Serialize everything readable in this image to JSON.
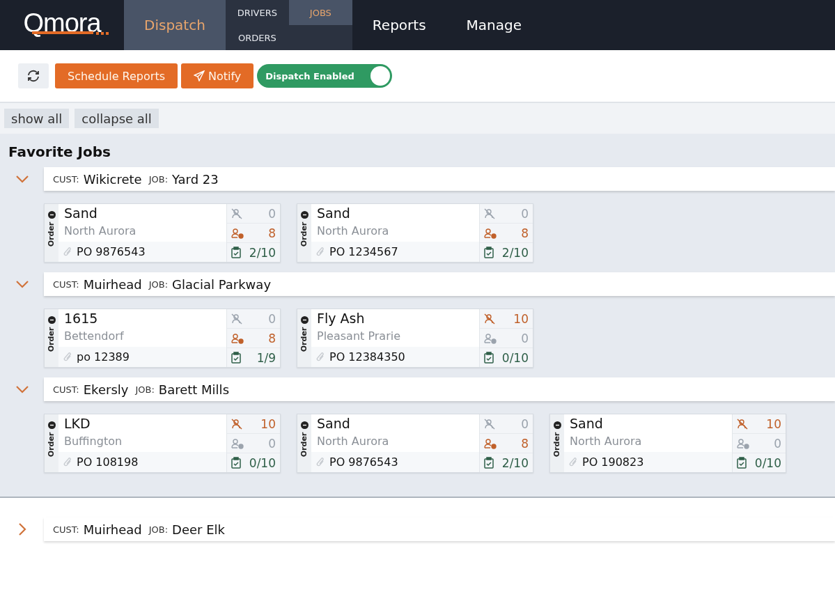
{
  "nav": {
    "logo": "Qmora",
    "tabs": [
      {
        "label": "Dispatch",
        "selected": true
      },
      {
        "kind": "sub",
        "items": [
          {
            "label": "DRIVERS",
            "selected": false
          },
          {
            "label": "JOBS",
            "selected": true
          },
          {
            "label": "ORDERS",
            "selected": false
          }
        ]
      },
      {
        "label": "Reports",
        "selected": false
      },
      {
        "label": "Manage",
        "selected": false
      }
    ]
  },
  "toolbar": {
    "buttons": [
      "Schedule Reports",
      "Notify"
    ],
    "toggle": {
      "label": "Dispatch Enabled",
      "on": true
    }
  },
  "view_buttons": [
    "show all",
    "collapse all"
  ],
  "section_title": "Favorite Jobs",
  "groups": [
    {
      "expanded": true,
      "cust_label": "CUST:",
      "customer": "Wikicrete",
      "job_label": "JOB:",
      "job": "Yard 23",
      "orders": [
        {
          "tag": "Order",
          "material": "Sand",
          "location": "North Aurora",
          "po": "PO 9876543",
          "stats": [
            {
              "kind": "unassigned",
              "value": "0",
              "active": false
            },
            {
              "kind": "assigned",
              "value": "8",
              "active": true
            },
            {
              "kind": "loads",
              "value": "2/10",
              "active": true
            }
          ]
        },
        {
          "tag": "Order",
          "material": "Sand",
          "location": "North Aurora",
          "po": "PO 1234567",
          "stats": [
            {
              "kind": "unassigned",
              "value": "0",
              "active": false
            },
            {
              "kind": "assigned",
              "value": "8",
              "active": true
            },
            {
              "kind": "loads",
              "value": "2/10",
              "active": true
            }
          ]
        }
      ]
    },
    {
      "expanded": true,
      "cust_label": "CUST:",
      "customer": "Muirhead",
      "job_label": "JOB:",
      "job": "Glacial Parkway",
      "orders": [
        {
          "tag": "Order",
          "material": "1615",
          "location": "Bettendorf",
          "po": "po 12389",
          "stats": [
            {
              "kind": "unassigned",
              "value": "0",
              "active": false
            },
            {
              "kind": "assigned",
              "value": "8",
              "active": true
            },
            {
              "kind": "loads",
              "value": "1/9",
              "active": true
            }
          ]
        },
        {
          "tag": "Order",
          "material": "Fly Ash",
          "location": "Pleasant Prarie",
          "po": "PO 12384350",
          "stats": [
            {
              "kind": "unassigned",
              "value": "10",
              "active": true
            },
            {
              "kind": "assigned",
              "value": "0",
              "active": false
            },
            {
              "kind": "loads",
              "value": "0/10",
              "active": true
            }
          ]
        }
      ]
    },
    {
      "expanded": true,
      "cust_label": "CUST:",
      "customer": "Ekersly",
      "job_label": "JOB:",
      "job": "Barett Mills",
      "orders": [
        {
          "tag": "Order",
          "material": "LKD",
          "location": "Buffington",
          "po": "PO 108198",
          "stats": [
            {
              "kind": "unassigned",
              "value": "10",
              "active": true
            },
            {
              "kind": "assigned",
              "value": "0",
              "active": false
            },
            {
              "kind": "loads",
              "value": "0/10",
              "active": true
            }
          ]
        },
        {
          "tag": "Order",
          "material": "Sand",
          "location": "North Aurora",
          "po": "PO 9876543",
          "stats": [
            {
              "kind": "unassigned",
              "value": "0",
              "active": false
            },
            {
              "kind": "assigned",
              "value": "8",
              "active": true
            },
            {
              "kind": "loads",
              "value": "2/10",
              "active": true
            }
          ]
        },
        {
          "tag": "Order",
          "material": "Sand",
          "location": "North Aurora",
          "po": "PO 190823",
          "stats": [
            {
              "kind": "unassigned",
              "value": "10",
              "active": true
            },
            {
              "kind": "assigned",
              "value": "0",
              "active": false
            },
            {
              "kind": "loads",
              "value": "0/10",
              "active": true
            }
          ]
        }
      ]
    }
  ],
  "other_groups": [
    {
      "expanded": false,
      "cust_label": "CUST:",
      "customer": "Muirhead",
      "job_label": "JOB:",
      "job": "Deer Elk"
    }
  ]
}
